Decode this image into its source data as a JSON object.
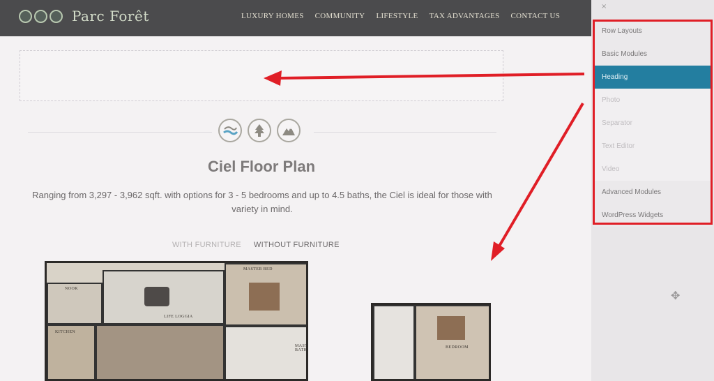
{
  "brand": {
    "name": "Parc Forêt"
  },
  "nav": {
    "items": [
      "LUXURY HOMES",
      "COMMUNITY",
      "LIFESTYLE",
      "TAX ADVANTAGES",
      "CONTACT US"
    ]
  },
  "main": {
    "title": "Ciel Floor Plan",
    "description": "Ranging from 3,297 - 3,962 sqft. with options for 3 - 5 bedrooms and up to 4.5 baths, the Ciel is ideal for those with variety in mind.",
    "tabs": {
      "with": "WITH FURNITURE",
      "without": "WITHOUT FURNITURE"
    },
    "plan_labels": {
      "nook": "NOOK",
      "loggia": "LIFE LOGGIA",
      "kitchen": "KITCHEN",
      "master_bed": "MASTER BED",
      "master_bath": "MASTER BATH",
      "bedroom": "BEDROOM"
    }
  },
  "sidebar": {
    "close": "×",
    "items": [
      {
        "label": "Row Layouts",
        "kind": "section"
      },
      {
        "label": "Basic Modules",
        "kind": "section"
      },
      {
        "label": "Heading",
        "kind": "active"
      },
      {
        "label": "Photo",
        "kind": "sub"
      },
      {
        "label": "Separator",
        "kind": "sub"
      },
      {
        "label": "Text Editor",
        "kind": "sub"
      },
      {
        "label": "Video",
        "kind": "sub"
      },
      {
        "label": "Advanced Modules",
        "kind": "section"
      },
      {
        "label": "WordPress Widgets",
        "kind": "section"
      }
    ]
  },
  "colors": {
    "nav_bg": "#4b4b4d",
    "active_item": "#237ea0",
    "annotation_red": "#e01e26"
  },
  "icons": [
    "river-icon",
    "tree-icon",
    "mountain-icon",
    "move-icon"
  ]
}
